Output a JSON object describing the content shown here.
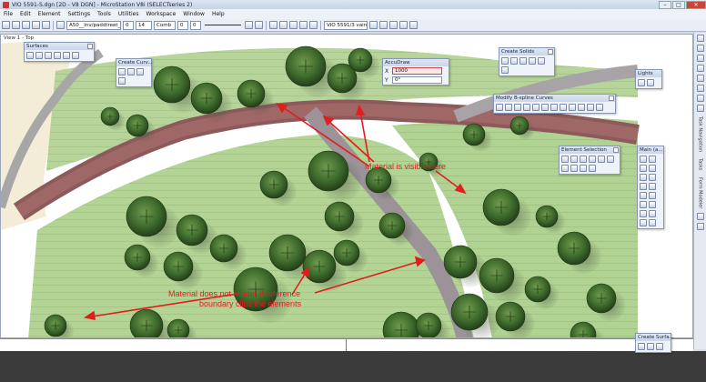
{
  "window": {
    "title": "VIO 5591-S.dgn [2D - V8 DGN] - MicroStation V8i (SELECTseries 2)",
    "close_glyph": "✕",
    "min_glyph": "–",
    "max_glyph": "□"
  },
  "menu": {
    "items": [
      "File",
      "Edit",
      "Element",
      "Settings",
      "Tools",
      "Utilities",
      "Workspace",
      "Window",
      "Help"
    ]
  },
  "toolbar": {
    "level": "A50__Inv/paddtreet_p",
    "color": "0",
    "weight_value": "14",
    "linestyle": "Comb",
    "weight": "0",
    "style_num": "0",
    "model": "VIO 5591/3 vain"
  },
  "view": {
    "label": "View 1 - Top"
  },
  "panels": {
    "surfaces": {
      "title": "Surfaces"
    },
    "create_curves": {
      "title": "Create Curv..."
    },
    "accudraw": {
      "title": "AccuDraw",
      "x_label": "X",
      "x_value": "1000",
      "y_label": "Y",
      "y_value": "0°"
    },
    "create_solids": {
      "title": "Create Solids"
    },
    "lights": {
      "title": "Lights"
    },
    "modify_bspline": {
      "title": "Modify B-spline Curves"
    },
    "element_selection": {
      "title": "Element Selection"
    },
    "main": {
      "title": "Main (a..."
    },
    "create_surfaces": {
      "title": "Create Surfa..."
    }
  },
  "right_tools": {
    "labels": [
      "Task Navigation",
      "Tasks",
      "Form Modeler"
    ]
  },
  "annotations": {
    "visible": "Material is visible here",
    "clip_line1": "Material does not render if reference",
    "clip_line2": "boundary clips the elements"
  },
  "colors": {
    "annotation": "#e11d1d",
    "path": "#8c5a5a",
    "lawn": "#a9cf87",
    "tree": "#3f6b2c"
  }
}
